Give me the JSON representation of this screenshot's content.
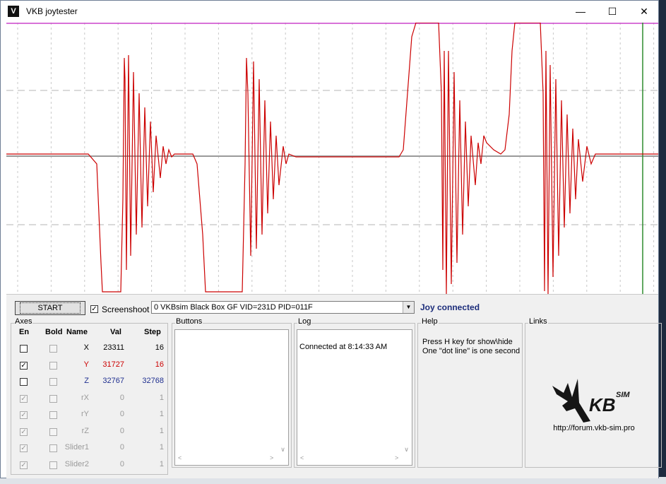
{
  "window": {
    "title": "VKB joytester",
    "minimize_label": "—",
    "maximize_label": "☐",
    "close_label": "✕"
  },
  "controls": {
    "start_label": "START",
    "screenshot_label": "Screenshoot",
    "screenshot_checked": true,
    "device_selected": "0 VKBsim Black Box GF  VID=231D PID=011F",
    "status": "Joy connected"
  },
  "axes": {
    "title": "Axes",
    "headers": {
      "en": "En",
      "bold": "Bold",
      "name": "Name",
      "val": "Val",
      "step": "Step"
    },
    "rows": [
      {
        "name": "X",
        "val": "23311",
        "step": "16",
        "en": false,
        "bold": false,
        "enabled": true,
        "color": "#000000"
      },
      {
        "name": "Y",
        "val": "31727",
        "step": "16",
        "en": true,
        "bold": false,
        "enabled": true,
        "color": "#cc0000"
      },
      {
        "name": "Z",
        "val": "32767",
        "step": "32768",
        "en": false,
        "bold": false,
        "enabled": true,
        "color": "#1f2f8f"
      },
      {
        "name": "rX",
        "val": "0",
        "step": "1",
        "en": true,
        "bold": false,
        "enabled": false,
        "color": "#9a9a9a"
      },
      {
        "name": "rY",
        "val": "0",
        "step": "1",
        "en": true,
        "bold": false,
        "enabled": false,
        "color": "#9a9a9a"
      },
      {
        "name": "rZ",
        "val": "0",
        "step": "1",
        "en": true,
        "bold": false,
        "enabled": false,
        "color": "#9a9a9a"
      },
      {
        "name": "Slider1",
        "val": "0",
        "step": "1",
        "en": true,
        "bold": false,
        "enabled": false,
        "color": "#9a9a9a"
      },
      {
        "name": "Slider2",
        "val": "0",
        "step": "1",
        "en": true,
        "bold": false,
        "enabled": false,
        "color": "#9a9a9a"
      }
    ]
  },
  "buttons_group": {
    "title": "Buttons"
  },
  "log": {
    "title": "Log",
    "lines": [
      "Connected at 8:14:33 AM"
    ]
  },
  "help": {
    "title": "Help",
    "line1": "Press H key for show\\hide",
    "line2": "One \"dot line\" is one second"
  },
  "links": {
    "title": "Links",
    "logo_text": "KB",
    "logo_sup": "SIM",
    "url": "http://forum.vkb-sim.pro"
  },
  "colors": {
    "trace": "#cc0000",
    "top_line": "#cc44cc",
    "center_line": "#9a9a9a",
    "cursor_line": "#2e8b2e",
    "status": "#1b2c7a"
  }
}
